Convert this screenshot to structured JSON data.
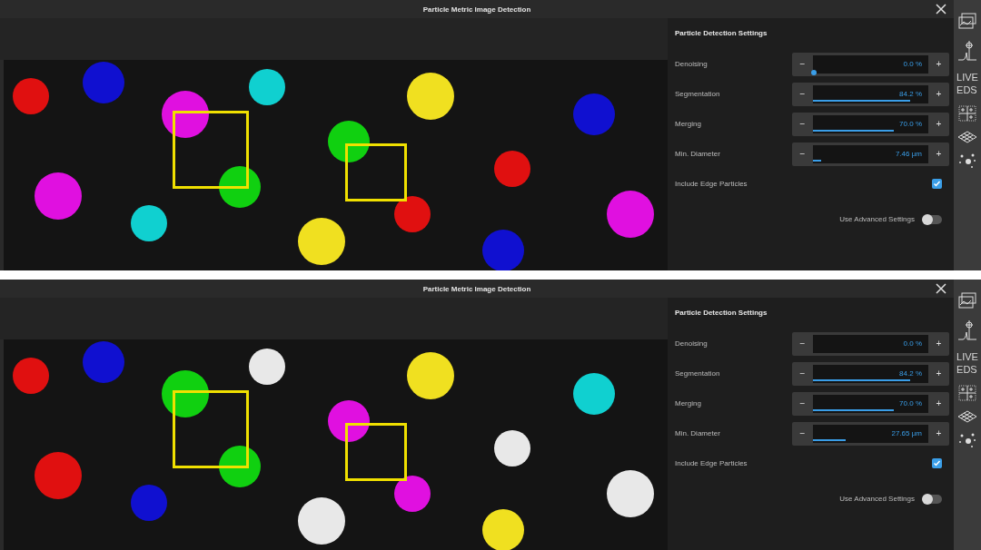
{
  "panels": [
    {
      "window": {
        "title": "Particle Metric Image Detection"
      },
      "settings": {
        "title": "Particle Detection Settings",
        "sliders": [
          {
            "label": "Denoising",
            "reading": "0.0 %",
            "level": 0,
            "focused": true
          },
          {
            "label": "Segmentation",
            "reading": "84.2 %",
            "level": 0.842,
            "focused": false
          },
          {
            "label": "Merging",
            "reading": "70.0 %",
            "level": 0.7,
            "focused": false
          },
          {
            "label": "Min. Diameter",
            "reading": "7.46 µm",
            "level": 0.07,
            "focused": false
          }
        ],
        "include_edge": {
          "label": "Include Edge Particles",
          "checked": true
        },
        "advanced": {
          "label": "Use Advanced Settings",
          "on": false
        }
      },
      "sidebar_text": [
        "LIVE",
        "EDS"
      ],
      "stepper_symbols": {
        "decrement": "−",
        "increment": "+"
      }
    },
    {
      "window": {
        "title": "Particle Metric Image Detection"
      },
      "settings": {
        "title": "Particle Detection Settings",
        "sliders": [
          {
            "label": "Denoising",
            "reading": "0.0 %",
            "level": 0,
            "focused": false
          },
          {
            "label": "Segmentation",
            "reading": "84.2 %",
            "level": 0.842,
            "focused": false
          },
          {
            "label": "Merging",
            "reading": "70.0 %",
            "level": 0.7,
            "focused": false
          },
          {
            "label": "Min. Diameter",
            "reading": "27.65 µm",
            "level": 0.28,
            "focused": false
          }
        ],
        "include_edge": {
          "label": "Include Edge Particles",
          "checked": true
        },
        "advanced": {
          "label": "Use Advanced Settings",
          "on": false
        }
      },
      "sidebar_text": [
        "LIVE",
        "EDS"
      ],
      "stepper_symbols": {
        "decrement": "−",
        "increment": "+"
      }
    }
  ]
}
